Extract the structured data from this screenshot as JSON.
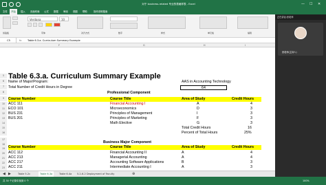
{
  "window": {
    "title": "对于 business-related 专业的表格样表 - Excel"
  },
  "ribbon": {
    "tabs": [
      "文件",
      "开始",
      "插入",
      "页面布局",
      "公式",
      "数据",
      "审阅",
      "视图",
      "帮助",
      "操作说明搜索"
    ],
    "active_tab": "开始",
    "font_name": "Verdana",
    "font_size": "10",
    "groups": [
      "剪贴板",
      "字体",
      "对齐方式",
      "数字",
      "样式",
      "单元格",
      "编辑"
    ]
  },
  "video_panel": {
    "header": "正在讲话:张老师",
    "participant_name": "张老师(主持人)"
  },
  "formula_bar": {
    "cell_ref": "C5",
    "content": "Table 6.3.a. Curriculum Summary Example"
  },
  "columns": [
    "F",
    "G",
    "H",
    "I"
  ],
  "rows": [
    {
      "n": "5"
    },
    {
      "n": "6"
    },
    {
      "n": "7"
    },
    {
      "n": "8"
    },
    {
      "n": "9"
    },
    {
      "n": "10"
    },
    {
      "n": "11"
    },
    {
      "n": "12"
    },
    {
      "n": "13"
    },
    {
      "n": "14"
    },
    {
      "n": "15"
    },
    {
      "n": "16"
    },
    {
      "n": "17"
    },
    {
      "n": "18"
    },
    {
      "n": "19"
    },
    {
      "n": "20"
    },
    {
      "n": "21"
    },
    {
      "n": "22"
    },
    {
      "n": "23"
    }
  ],
  "sheet": {
    "title": "Table 6.3.a.  Curriculum Summary Example",
    "major_label": "Name of Major/Program:",
    "major_value": "AAS in Accounting Technology",
    "credits_label": "Total Number of Credit Hours in Degree",
    "credits_value": "64",
    "professional_header": "Professional Component",
    "headers": {
      "course_number": "Course Number",
      "course_title": "Course Title",
      "area": "Area of Study",
      "credit_hours": "Credit Hours"
    },
    "professional_rows": [
      {
        "num": "ACC 111",
        "title": "Financial Accounting I",
        "area": "A",
        "hours": "4"
      },
      {
        "num": "ECO 101",
        "title": "Microeconomics",
        "area": "D",
        "hours": "3"
      },
      {
        "num": "BUS 231",
        "title": "Principles of Management",
        "area": "I",
        "hours": "3"
      },
      {
        "num": "BUS 201",
        "title": "Principles of Marketing",
        "area": "F",
        "hours": "3"
      },
      {
        "num": "",
        "title": "Math Elective",
        "area": "G",
        "hours": "3"
      }
    ],
    "total_label": "Total Credit Hours",
    "total_value": "16",
    "percent_label": "Percent of Total Hours",
    "percent_value": "25%",
    "major_component_header": "Business Major Component",
    "major_rows": [
      {
        "num": "ACC 112",
        "title": "Financial Accounting II",
        "area": "A",
        "hours": "4"
      },
      {
        "num": "ACC 213",
        "title": "Managerial Accounting",
        "area": "A",
        "hours": "4"
      },
      {
        "num": "ACC 217",
        "title": "Accounting Software Applications",
        "area": "B",
        "hours": "3"
      },
      {
        "num": "ACC 211",
        "title": "Intermediate Accounting I",
        "area": "A",
        "hours": "3"
      }
    ]
  },
  "sheet_tabs": [
    "Table 5.2c",
    "Table 6.3a",
    "Table 6.4a",
    "5.2-6.2 Deployment of Faculty"
  ],
  "active_sheet": "Table 6.3a",
  "status": {
    "left": "共 30 个记录中找到 0 个",
    "zoom": "100%"
  }
}
